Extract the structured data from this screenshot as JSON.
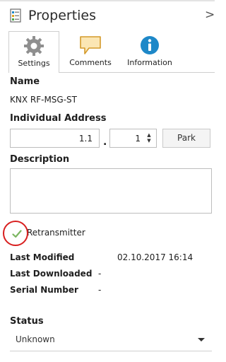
{
  "header": {
    "title": "Properties",
    "icon": "properties-icon",
    "collapse_glyph": ">"
  },
  "tabs": [
    {
      "label": "Settings",
      "icon": "gear-icon",
      "active": true
    },
    {
      "label": "Comments",
      "icon": "comment-bubble-icon",
      "active": false
    },
    {
      "label": "Information",
      "icon": "info-icon",
      "active": false
    }
  ],
  "name": {
    "label": "Name",
    "value": "KNX RF-MSG-ST"
  },
  "address": {
    "label": "Individual Address",
    "area_line": "1.1",
    "separator": ".",
    "device": "1",
    "park_label": "Park"
  },
  "description": {
    "label": "Description",
    "value": ""
  },
  "retransmitter": {
    "label": "Retransmitter",
    "checked": true
  },
  "info": [
    {
      "label": "Last Modified",
      "value": "02.10.2017 16:14"
    },
    {
      "label": "Last Downloaded",
      "value": "-"
    },
    {
      "label": "Serial Number",
      "value": "-"
    }
  ],
  "status": {
    "label": "Status",
    "value": "Unknown"
  },
  "colors": {
    "accent": "#1e88c8",
    "highlight_circle": "#d81f1f",
    "check_green": "#7bb661"
  }
}
